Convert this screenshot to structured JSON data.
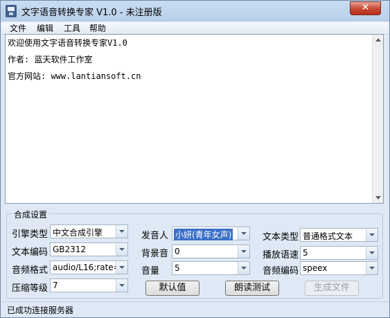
{
  "window": {
    "title": "文字语音转换专家 V1.0  - 未注册版",
    "close_glyph": "✕"
  },
  "menu": [
    "文件",
    "编辑",
    "工具",
    "帮助"
  ],
  "editor": {
    "lines": [
      "欢迎使用文字语音转换专家V1.0",
      "作者: 蓝天软件工作室",
      "官方网站: www.lantiansoft.cn"
    ]
  },
  "settings": {
    "group_title": "合成设置",
    "engine_type": {
      "label": "引擎类型",
      "value": "中文合成引擎"
    },
    "text_encoding": {
      "label": "文本编码",
      "value": "GB2312"
    },
    "audio_format": {
      "label": "音频格式",
      "value": "audio/L16;rate="
    },
    "compression": {
      "label": "压缩等级",
      "value": "7"
    },
    "speaker": {
      "label": "发音人",
      "value": "小妍(青年女声)"
    },
    "background": {
      "label": "背景音",
      "value": "0"
    },
    "volume": {
      "label": "音量",
      "value": "5"
    },
    "text_type": {
      "label": "文本类型",
      "value": "普通格式文本"
    },
    "speed": {
      "label": "播放语速",
      "value": "5"
    },
    "audio_encoding": {
      "label": "音频编码",
      "value": "speex"
    }
  },
  "buttons": {
    "default": "默认值",
    "read_test": "朗读测试",
    "generate": "生成文件"
  },
  "status": "已成功连接服务器"
}
